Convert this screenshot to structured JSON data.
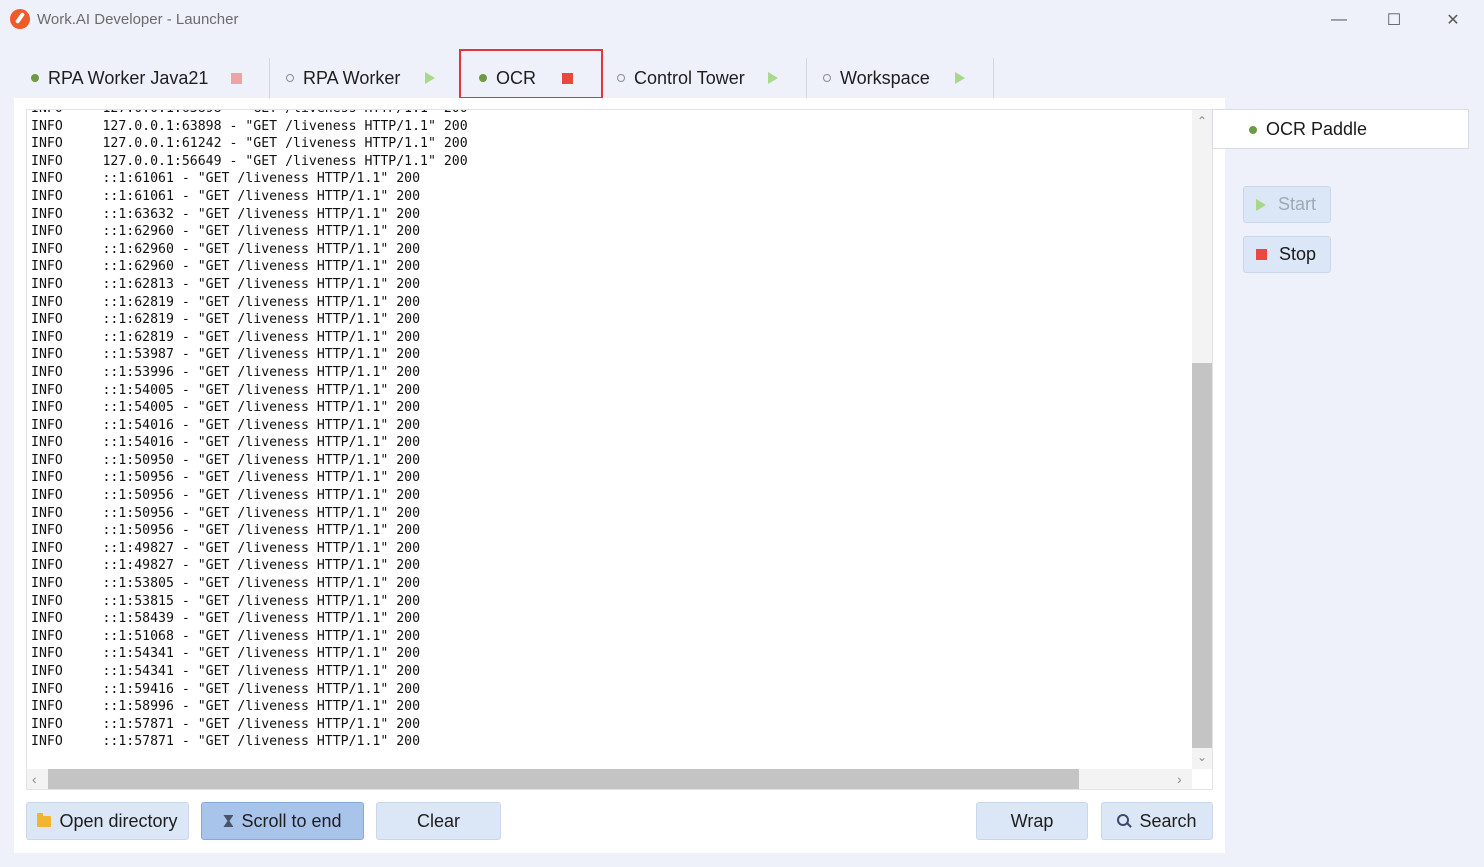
{
  "window": {
    "title": "Work.AI Developer - Launcher",
    "min_glyph": "—",
    "max_glyph": "☐",
    "close_glyph": "✕"
  },
  "tabs": [
    {
      "label": "RPA Worker Java21",
      "running": true,
      "control": "stop"
    },
    {
      "label": "RPA Worker",
      "running": false,
      "control": "start"
    },
    {
      "label": "OCR",
      "running": true,
      "control": "stop",
      "active": true
    },
    {
      "label": "Control Tower",
      "running": false,
      "control": "start"
    },
    {
      "label": "Workspace",
      "running": false,
      "control": "start"
    }
  ],
  "console": {
    "lines": [
      "INFO     127.0.0.1:63898 - \"GET /liveness HTTP/1.1\" 200",
      "INFO     127.0.0.1:63898 - \"GET /liveness HTTP/1.1\" 200",
      "INFO     127.0.0.1:61242 - \"GET /liveness HTTP/1.1\" 200",
      "INFO     127.0.0.1:56649 - \"GET /liveness HTTP/1.1\" 200",
      "INFO     ::1:61061 - \"GET /liveness HTTP/1.1\" 200",
      "INFO     ::1:61061 - \"GET /liveness HTTP/1.1\" 200",
      "INFO     ::1:63632 - \"GET /liveness HTTP/1.1\" 200",
      "INFO     ::1:62960 - \"GET /liveness HTTP/1.1\" 200",
      "INFO     ::1:62960 - \"GET /liveness HTTP/1.1\" 200",
      "INFO     ::1:62960 - \"GET /liveness HTTP/1.1\" 200",
      "INFO     ::1:62813 - \"GET /liveness HTTP/1.1\" 200",
      "INFO     ::1:62819 - \"GET /liveness HTTP/1.1\" 200",
      "INFO     ::1:62819 - \"GET /liveness HTTP/1.1\" 200",
      "INFO     ::1:62819 - \"GET /liveness HTTP/1.1\" 200",
      "INFO     ::1:53987 - \"GET /liveness HTTP/1.1\" 200",
      "INFO     ::1:53996 - \"GET /liveness HTTP/1.1\" 200",
      "INFO     ::1:54005 - \"GET /liveness HTTP/1.1\" 200",
      "INFO     ::1:54005 - \"GET /liveness HTTP/1.1\" 200",
      "INFO     ::1:54016 - \"GET /liveness HTTP/1.1\" 200",
      "INFO     ::1:54016 - \"GET /liveness HTTP/1.1\" 200",
      "INFO     ::1:50950 - \"GET /liveness HTTP/1.1\" 200",
      "INFO     ::1:50956 - \"GET /liveness HTTP/1.1\" 200",
      "INFO     ::1:50956 - \"GET /liveness HTTP/1.1\" 200",
      "INFO     ::1:50956 - \"GET /liveness HTTP/1.1\" 200",
      "INFO     ::1:50956 - \"GET /liveness HTTP/1.1\" 200",
      "INFO     ::1:49827 - \"GET /liveness HTTP/1.1\" 200",
      "INFO     ::1:49827 - \"GET /liveness HTTP/1.1\" 200",
      "INFO     ::1:53805 - \"GET /liveness HTTP/1.1\" 200",
      "INFO     ::1:53815 - \"GET /liveness HTTP/1.1\" 200",
      "INFO     ::1:58439 - \"GET /liveness HTTP/1.1\" 200",
      "INFO     ::1:51068 - \"GET /liveness HTTP/1.1\" 200",
      "INFO     ::1:54341 - \"GET /liveness HTTP/1.1\" 200",
      "INFO     ::1:54341 - \"GET /liveness HTTP/1.1\" 200",
      "INFO     ::1:59416 - \"GET /liveness HTTP/1.1\" 200",
      "INFO     ::1:58996 - \"GET /liveness HTTP/1.1\" 200",
      "INFO     ::1:57871 - \"GET /liveness HTTP/1.1\" 200",
      "INFO     ::1:57871 - \"GET /liveness HTTP/1.1\" 200"
    ]
  },
  "toolbar": {
    "open_directory": "Open directory",
    "scroll_to_end": "Scroll to end",
    "clear": "Clear",
    "wrap": "Wrap",
    "search": "Search"
  },
  "services": {
    "items": [
      {
        "label": "OCR Paddle",
        "running": true
      }
    ],
    "start_label": "Start",
    "stop_label": "Stop"
  },
  "colors": {
    "running_dot": "#6c9a45",
    "stop_square": "#e8483f",
    "stop_square_muted": "#f0a3a3",
    "start_triangle": "#a8d98a",
    "active_tab_outline": "#e0353b"
  }
}
